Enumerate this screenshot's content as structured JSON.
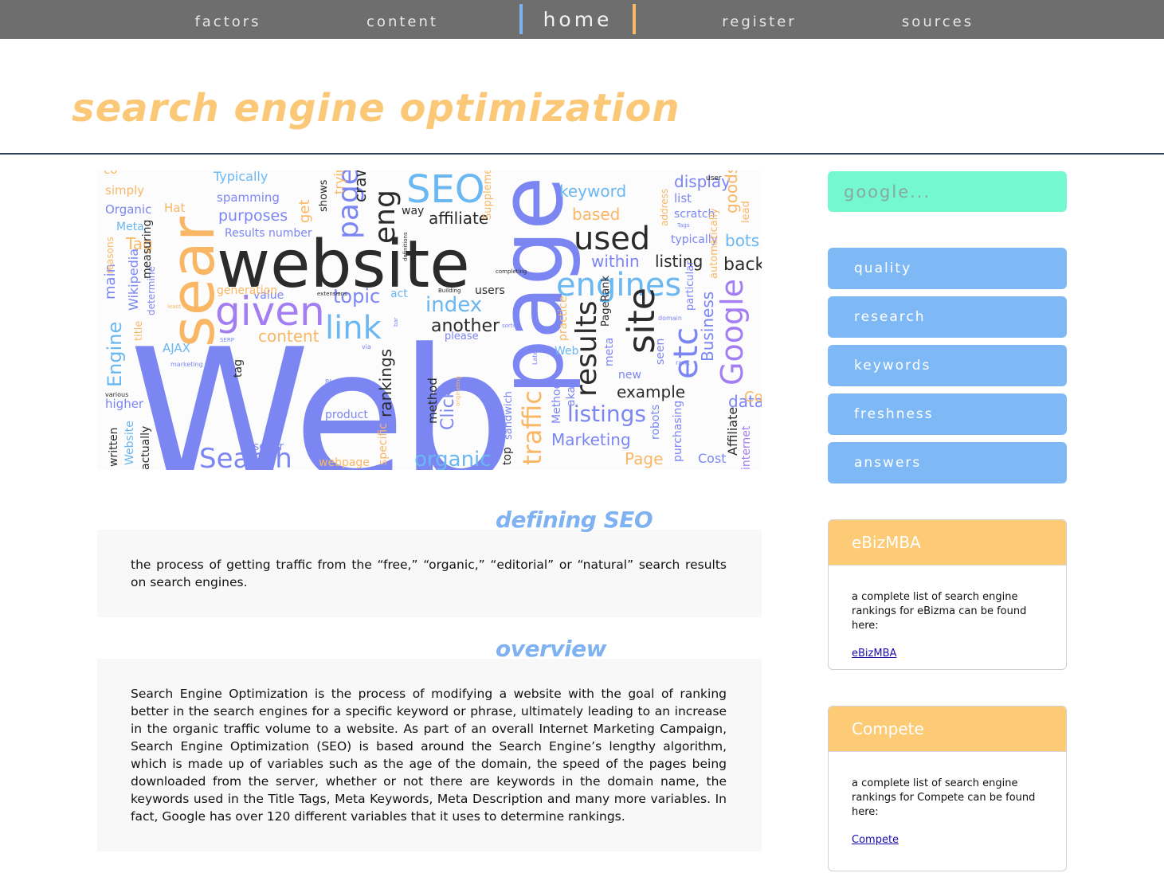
{
  "nav": {
    "items": [
      "factors",
      "content",
      "home",
      "register",
      "sources"
    ],
    "active": "home"
  },
  "page": {
    "title": "search engine optimization"
  },
  "word_cloud": {
    "words": [
      "Web",
      "website",
      "page",
      "sear",
      "SEO",
      "engines",
      "given",
      "link",
      "results",
      "site",
      "Google",
      "etc",
      "used",
      "index",
      "topic",
      "another",
      "traffic",
      "listings",
      "organic",
      "Search",
      "keyword",
      "based",
      "within",
      "listing",
      "back",
      "bots",
      "example",
      "Marketing",
      "Page",
      "eng",
      "pages",
      "affiliate",
      "content",
      "Engine",
      "Business",
      "way",
      "Typically",
      "spamming",
      "purposes",
      "Results number",
      "Organic",
      "Meta",
      "Tag",
      "simply",
      "Hat",
      "main",
      "Wikipedia",
      "title",
      "AJAX",
      "higher",
      "written",
      "Website",
      "actually",
      "pays",
      "scour",
      "webpage",
      "product",
      "rankings",
      "method",
      "Click",
      "sandwich",
      "top",
      "specific",
      "Method",
      "aka",
      "robots",
      "purchasing",
      "Cost",
      "Affiliate",
      "internet",
      "data",
      "Web",
      "new",
      "seen",
      "PageRank",
      "meta",
      "practice",
      "please",
      "users",
      "act",
      "value",
      "generation",
      "tag",
      "driving",
      "determine",
      "measuring",
      "get",
      "shows",
      "display",
      "list",
      "scratch",
      "typically",
      "goods",
      "lead",
      "address",
      "automatically",
      "particular",
      "user",
      "Supplemental",
      "reasons",
      "various",
      "Consortium",
      "marketing",
      "Black",
      "Latent",
      "rank",
      "domain",
      "Tags",
      "completing",
      "Building",
      "definitions",
      "sorts",
      "extensions",
      "least",
      "SERP",
      "via",
      "bar",
      "originating",
      "trying",
      "craw",
      "co",
      "See"
    ]
  },
  "sections": [
    {
      "heading": "defining SEO",
      "body": "the process of getting traffic from the “free,” “organic,” “editorial” or “natural” search results on search engines."
    },
    {
      "heading": "overview",
      "body": "Search Engine Optimization is the process of modifying a website with the goal of ranking better in the search engines for a specific keyword or phrase, ultimately leading to an increase in the organic traffic volume to a website. As part of an overall Internet Marketing Campaign, Search Engine Optimization (SEO) is based around the Search Engine’s lengthy algorithm, which is made up of variables such as the age of the domain, the speed of the pages being downloaded from the server, whether or not there are keywords in the domain name, the keywords used in the Title Tags, Meta Keywords, Meta Description and many more variables. In fact, Google has over 120 different variables that it uses to determine rankings."
    }
  ],
  "sidebar": {
    "search_placeholder": "google...",
    "buttons": [
      "quality",
      "research",
      "keywords",
      "freshness",
      "answers"
    ],
    "cards": [
      {
        "title": "eBizMBA",
        "text": "a complete list of search engine rankings for eBizma can be found here:",
        "link": "eBizMBA"
      },
      {
        "title": "Compete",
        "text": "a complete list of search engine rankings for Compete can be found here:",
        "link": "Compete"
      }
    ]
  },
  "colors": {
    "nav_bg": "#6e6e6e",
    "title": "#fbc877",
    "heading_blue": "#7fb2f0",
    "search_bg": "#74f8cf",
    "button_bg": "#7fb9f5",
    "card_head": "#fdca75",
    "cloud_blue": "#7b86f3",
    "cloud_dark": "#2b2b2b",
    "cloud_orange": "#f9b766",
    "cloud_light_blue": "#6ab7f1"
  }
}
